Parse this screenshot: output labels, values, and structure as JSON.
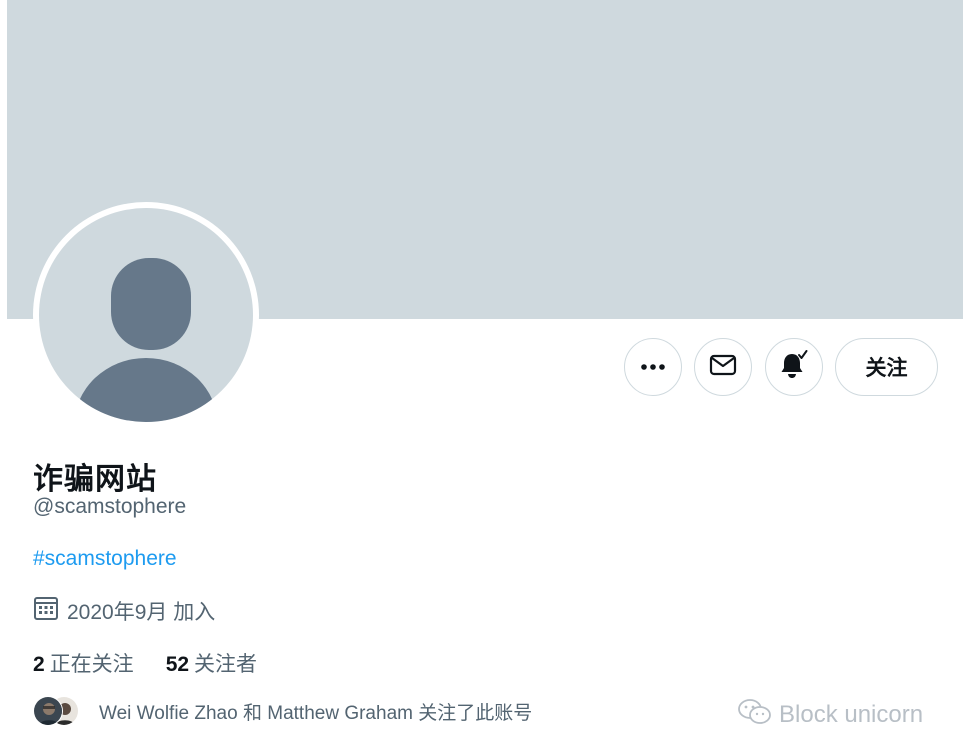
{
  "profile": {
    "display_name": "诈骗网站",
    "handle": "@scamstophere",
    "bio_hashtag": "#scamstophere",
    "joined": "2020年9月 加入",
    "following_count": "2",
    "following_label": "正在关注",
    "followers_count": "52",
    "followers_label": "关注者",
    "followed_by_text": "Wei Wolfie Zhao 和 Matthew Graham 关注了此账号"
  },
  "actions": {
    "more_icon": "more-horizontal-icon",
    "message_icon": "envelope-icon",
    "notify_icon": "bell-check-icon",
    "follow_label": "关注"
  },
  "watermark": {
    "text": "Block unicorn",
    "icon": "wechat-icon"
  },
  "colors": {
    "banner": "#cfd9de",
    "avatar_placeholder": "#66788a",
    "link": "#1d9bf0",
    "secondary_text": "#536471",
    "primary_text": "#0f1419"
  }
}
